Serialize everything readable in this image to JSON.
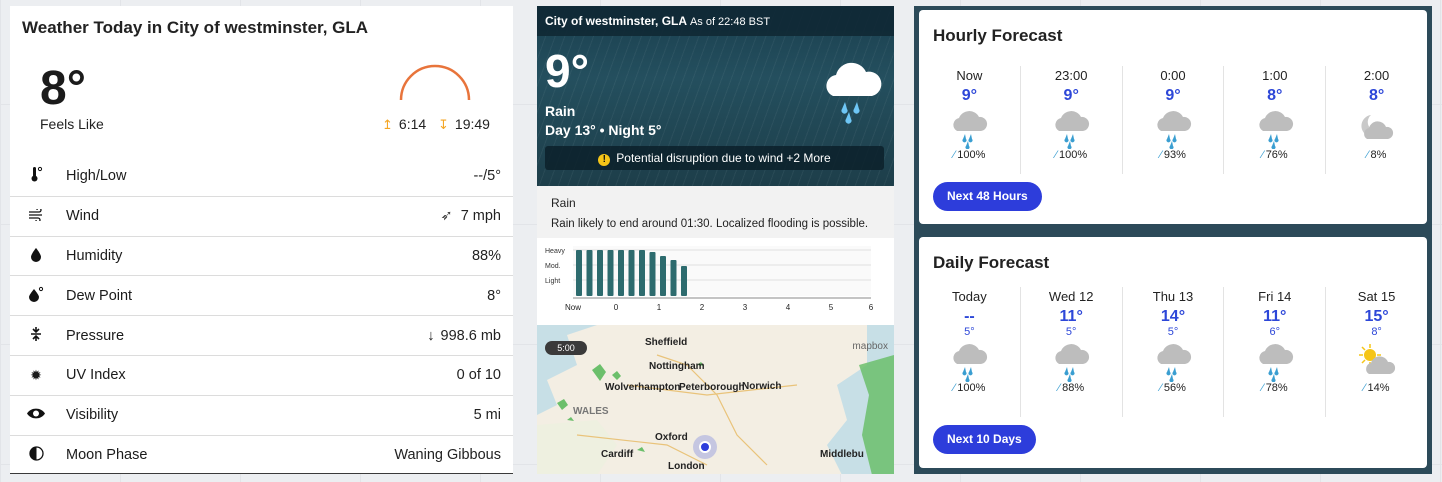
{
  "today": {
    "title": "Weather Today in City of westminster, GLA",
    "feels_temp": "8°",
    "feels_label": "Feels Like",
    "sunrise": "6:14",
    "sunset": "19:49",
    "rows": [
      {
        "icon": "thermometer-icon",
        "label": "High/Low",
        "value": "--/5°"
      },
      {
        "icon": "wind-icon",
        "label": "Wind",
        "value": "7 mph"
      },
      {
        "icon": "drop-icon",
        "label": "Humidity",
        "value": "88%"
      },
      {
        "icon": "dew-point-icon",
        "label": "Dew Point",
        "value": "8°"
      },
      {
        "icon": "pressure-icon",
        "label": "Pressure",
        "value": "998.6 mb"
      },
      {
        "icon": "uv-icon",
        "label": "UV Index",
        "value": "0 of 10"
      },
      {
        "icon": "eye-icon",
        "label": "Visibility",
        "value": "5 mi"
      },
      {
        "icon": "moon-icon",
        "label": "Moon Phase",
        "value": "Waning Gibbous"
      }
    ]
  },
  "now": {
    "location": "City of westminster, GLA",
    "as_of": "As of 22:48 BST",
    "temp": "9°",
    "condition": "Rain",
    "day_night": "Day 13° • Night 5°",
    "alert": "Potential disruption due to wind +2 More",
    "rain_title": "Rain",
    "rain_desc": "Rain likely to end around 01:30. Localized flooding is possible.",
    "rain_levels": [
      "Heavy",
      "Mod.",
      "Light"
    ],
    "rain_ticks": [
      "Now",
      "0",
      "1",
      "2",
      "3",
      "4",
      "5",
      "6"
    ],
    "map_time": "5:00",
    "map_brand": "mapbox",
    "map_places": [
      "Sheffield",
      "Nottingham",
      "Wolverhampton",
      "Peterborough",
      "Norwich",
      "WALES",
      "Oxford",
      "Cardiff",
      "London",
      "Middlebu"
    ]
  },
  "hourly": {
    "title": "Hourly Forecast",
    "items": [
      {
        "time": "Now",
        "temp": "9°",
        "precip": "100%",
        "icon": "rain-cloud-icon"
      },
      {
        "time": "23:00",
        "temp": "9°",
        "precip": "100%",
        "icon": "rain-cloud-icon"
      },
      {
        "time": "0:00",
        "temp": "9°",
        "precip": "93%",
        "icon": "rain-cloud-icon"
      },
      {
        "time": "1:00",
        "temp": "8°",
        "precip": "76%",
        "icon": "rain-cloud-icon"
      },
      {
        "time": "2:00",
        "temp": "8°",
        "precip": "8%",
        "icon": "moon-cloud-icon"
      }
    ],
    "button": "Next 48 Hours"
  },
  "daily": {
    "title": "Daily Forecast",
    "items": [
      {
        "day": "Today",
        "high": "--",
        "low": "5°",
        "precip": "100%",
        "icon": "rain-cloud-icon"
      },
      {
        "day": "Wed 12",
        "high": "11°",
        "low": "5°",
        "precip": "88%",
        "icon": "rain-cloud-icon"
      },
      {
        "day": "Thu 13",
        "high": "14°",
        "low": "5°",
        "precip": "56%",
        "icon": "rain-cloud-icon"
      },
      {
        "day": "Fri 14",
        "high": "11°",
        "low": "6°",
        "precip": "78%",
        "icon": "rain-cloud-icon"
      },
      {
        "day": "Sat 15",
        "high": "15°",
        "low": "8°",
        "precip": "14%",
        "icon": "sun-cloud-icon"
      }
    ],
    "button": "Next 10 Days"
  },
  "colors": {
    "accent": "#2d3ddb",
    "temp": "#2d47d8",
    "sun_arc": "#e8743b",
    "rain_bar": "#2d6b6e"
  }
}
